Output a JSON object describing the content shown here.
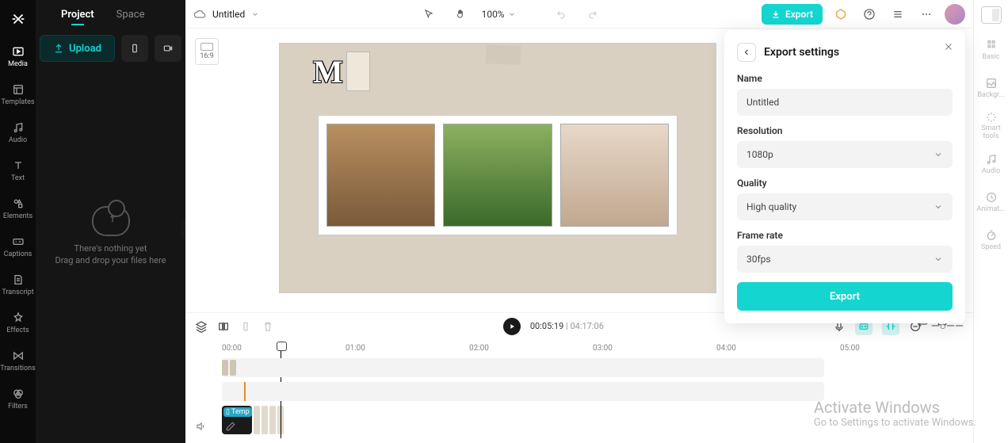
{
  "left_rail": {
    "items": [
      {
        "label": "Media"
      },
      {
        "label": "Templates"
      },
      {
        "label": "Audio"
      },
      {
        "label": "Text"
      },
      {
        "label": "Elements"
      },
      {
        "label": "Captions"
      },
      {
        "label": "Transcript"
      },
      {
        "label": "Effects"
      },
      {
        "label": "Transitions"
      },
      {
        "label": "Filters"
      }
    ]
  },
  "side_panel": {
    "tabs": {
      "project": "Project",
      "space": "Space"
    },
    "upload_label": "Upload",
    "empty_line1": "There's nothing yet",
    "empty_line2": "Drag and drop your files here"
  },
  "top_bar": {
    "doc_title": "Untitled",
    "zoom": "100%",
    "export_label": "Export"
  },
  "stage": {
    "ratio": "16:9",
    "overlay_text": "M"
  },
  "controls": {
    "current": "00:05:19",
    "duration": "04:17:06"
  },
  "timeline": {
    "marks": [
      "00:00",
      "01:00",
      "02:00",
      "03:00",
      "04:00",
      "05:00"
    ],
    "clip_label": "Temp"
  },
  "export_panel": {
    "title": "Export settings",
    "name_label": "Name",
    "name_value": "Untitled",
    "res_label": "Resolution",
    "res_value": "1080p",
    "quality_label": "Quality",
    "quality_value": "High quality",
    "fps_label": "Frame rate",
    "fps_value": "30fps",
    "export_btn": "Export"
  },
  "right_rail": {
    "items": [
      {
        "label": "Basic"
      },
      {
        "label": "Backgr..."
      },
      {
        "label": "Smart tools"
      },
      {
        "label": "Audio"
      },
      {
        "label": "Animat..."
      },
      {
        "label": "Speed"
      }
    ]
  },
  "windows_overlay": {
    "line1": "Activate Windows",
    "line2": "Go to Settings to activate Windows."
  }
}
